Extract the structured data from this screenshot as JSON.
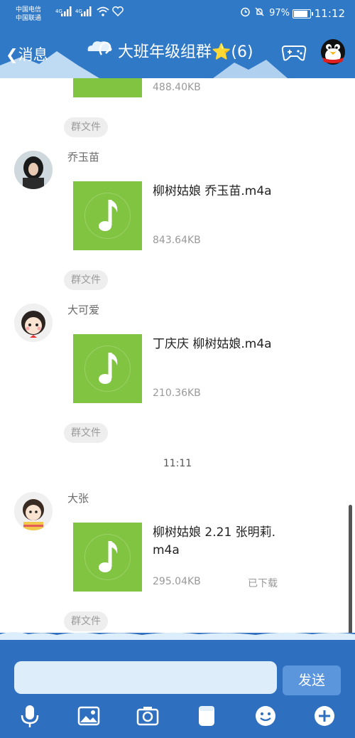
{
  "status_bar": {
    "carrier_line1": "中国电信",
    "carrier_line2": "中国联通",
    "network1": "4G",
    "network2": "4G",
    "battery": "97%",
    "battery_level": 0.97,
    "time": "11:12"
  },
  "header": {
    "back_label": "消息",
    "title": "大班年级组群⭐(6)"
  },
  "chat": {
    "top_partial": {
      "file_size": "488.40KB",
      "chip": "群文件"
    },
    "messages": [
      {
        "sender": "乔玉苗",
        "file_name": "柳树姑娘 乔玉苗.m4a",
        "file_size": "843.64KB",
        "chip": "群文件"
      },
      {
        "sender": "大可爱",
        "file_name": "丁庆庆 柳树姑娘.m4a",
        "file_size": "210.36KB",
        "chip": "群文件"
      },
      {
        "sender": "大张",
        "file_name": "柳树姑娘 2.21 张明莉.m4a",
        "file_size": "295.04KB",
        "status": "已下载",
        "chip": "群文件"
      }
    ],
    "timestamp": "11:11"
  },
  "composer": {
    "input_value": "",
    "send_label": "发送",
    "toolbar": [
      "microphone-icon",
      "image-icon",
      "camera-icon",
      "file-icon",
      "emoji-icon",
      "plus-icon"
    ]
  },
  "colors": {
    "header_bg": "#2f79c7",
    "audio_thumb": "#80c442",
    "bottom_bg": "#2e6fbf",
    "input_bg": "#ddeefa",
    "send_bg": "#5b95dc"
  }
}
